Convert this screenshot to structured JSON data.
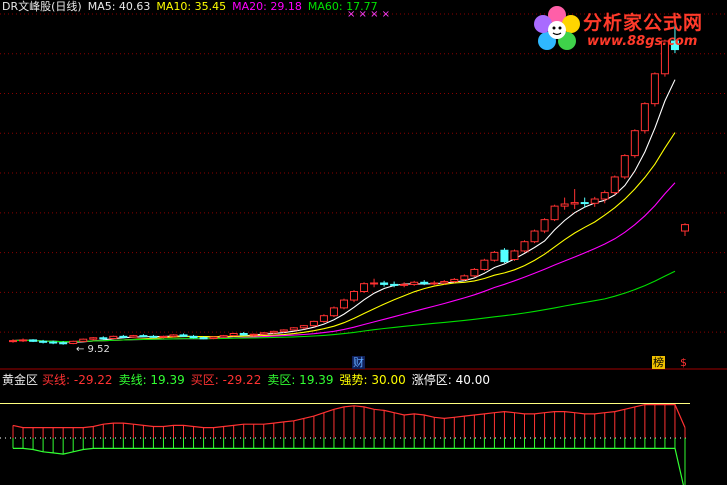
{
  "header": {
    "title": "DR文峰股(日线)",
    "ma5": "MA5: 40.63",
    "ma10": "MA10: 35.45",
    "ma20": "MA20: 29.18",
    "ma60": "MA60: 17.77",
    "x_marks": "× × × ×"
  },
  "lower_header": {
    "name": "黄金区",
    "buy_line": "买线: -29.22",
    "sell_line": "卖线: 19.39",
    "buy_zone": "买区: -29.22",
    "sell_zone": "卖区: 19.39",
    "strong": "强势: 30.00",
    "limit_zone": "涨停区: 40.00"
  },
  "markers": {
    "low_price": "← 9.52",
    "cai": "财",
    "bang": "榜",
    "dollar": "$"
  },
  "logo": {
    "title": "分析家公式网",
    "url": "www.88gs.com"
  },
  "colors": {
    "up": "#ff3232",
    "down": "#54ffff",
    "ma5": "#ffffff",
    "ma10": "#ffff00",
    "ma20": "#ff00ff",
    "ma60": "#00e000",
    "grid": "#8b0000",
    "zone_line": "#ffff80"
  },
  "chart_data": [
    {
      "type": "candlestick",
      "y_range": [
        8.5,
        56
      ],
      "candles": [
        [
          10,
          10.3,
          9.8,
          10.1
        ],
        [
          10.1,
          10.4,
          9.9,
          10.2
        ],
        [
          10.2,
          10.3,
          9.9,
          10.0
        ],
        [
          10,
          10.2,
          9.7,
          9.9
        ],
        [
          9.9,
          10.1,
          9.6,
          9.8
        ],
        [
          9.8,
          10,
          9.52,
          9.7
        ],
        [
          9.7,
          10.1,
          9.6,
          10.0
        ],
        [
          10,
          10.4,
          9.9,
          10.3
        ],
        [
          10.3,
          10.6,
          10.1,
          10.5
        ],
        [
          10.5,
          10.7,
          10.2,
          10.4
        ],
        [
          10.4,
          10.8,
          10.3,
          10.7
        ],
        [
          10.7,
          10.9,
          10.4,
          10.6
        ],
        [
          10.6,
          10.9,
          10.5,
          10.8
        ],
        [
          10.8,
          11,
          10.6,
          10.7
        ],
        [
          10.7,
          10.9,
          10.5,
          10.6
        ],
        [
          10.6,
          10.8,
          10.4,
          10.7
        ],
        [
          10.7,
          11,
          10.5,
          10.9
        ],
        [
          10.9,
          11.1,
          10.6,
          10.7
        ],
        [
          10.7,
          10.9,
          10.4,
          10.5
        ],
        [
          10.5,
          10.7,
          10.3,
          10.4
        ],
        [
          10.4,
          10.7,
          10.3,
          10.6
        ],
        [
          10.6,
          10.9,
          10.5,
          10.8
        ],
        [
          10.8,
          11.2,
          10.7,
          11.1
        ],
        [
          11.1,
          11.3,
          10.8,
          10.9
        ],
        [
          10.9,
          11.1,
          10.7,
          11.0
        ],
        [
          11,
          11.3,
          10.9,
          11.2
        ],
        [
          11.2,
          11.5,
          11,
          11.4
        ],
        [
          11.4,
          11.7,
          11.2,
          11.6
        ],
        [
          11.6,
          12,
          11.5,
          11.9
        ],
        [
          11.9,
          12.3,
          11.7,
          12.2
        ],
        [
          12.2,
          12.9,
          12,
          12.8
        ],
        [
          12.8,
          13.8,
          12.6,
          13.6
        ],
        [
          13.6,
          14.9,
          13.4,
          14.7
        ],
        [
          14.7,
          16,
          14.5,
          15.8
        ],
        [
          15.8,
          17.2,
          15.5,
          17.0
        ],
        [
          17,
          18.3,
          16.8,
          18.1
        ],
        [
          18.1,
          18.8,
          17.6,
          18.2
        ],
        [
          18.2,
          18.5,
          17.7,
          18.0
        ],
        [
          18,
          18.4,
          17.6,
          17.9
        ],
        [
          17.9,
          18.3,
          17.6,
          18.0
        ],
        [
          18,
          18.5,
          17.8,
          18.3
        ],
        [
          18.3,
          18.6,
          17.9,
          18.1
        ],
        [
          18.1,
          18.5,
          17.9,
          18.2
        ],
        [
          18.2,
          18.6,
          18,
          18.4
        ],
        [
          18.4,
          18.9,
          18.2,
          18.7
        ],
        [
          18.7,
          19.4,
          18.5,
          19.2
        ],
        [
          19.2,
          20.3,
          19,
          20.1
        ],
        [
          20.1,
          21.6,
          19.9,
          21.4
        ],
        [
          21.4,
          22.7,
          21.2,
          22.5
        ],
        [
          22.8,
          23.1,
          21.0,
          21.2
        ],
        [
          21.5,
          22.9,
          21.3,
          22.7
        ],
        [
          22.7,
          24.2,
          22.5,
          24.0
        ],
        [
          24,
          25.7,
          23.8,
          25.5
        ],
        [
          25.5,
          27.3,
          25.2,
          27.1
        ],
        [
          27.1,
          29.2,
          26.9,
          29.0
        ],
        [
          29,
          30.2,
          28.5,
          29.3
        ],
        [
          29.3,
          31.4,
          28.6,
          29.5
        ],
        [
          29.5,
          30.2,
          28.8,
          29.4
        ],
        [
          29.4,
          30.3,
          28.9,
          30.0
        ],
        [
          30,
          31.2,
          29.4,
          30.9
        ],
        [
          30.9,
          33.3,
          30.6,
          33.1
        ],
        [
          33.1,
          36.3,
          32.8,
          36.1
        ],
        [
          36.1,
          39.8,
          35.8,
          39.6
        ],
        [
          39.6,
          43.6,
          39.2,
          43.4
        ],
        [
          43.4,
          47.8,
          43,
          47.6
        ],
        [
          47.6,
          52.4,
          47.2,
          52.2
        ],
        [
          52.2,
          55.5,
          50.5,
          51.0
        ],
        [
          25.5,
          26.6,
          24.8,
          26.4
        ]
      ]
    },
    {
      "type": "bar",
      "y_range": [
        -40,
        40
      ],
      "buy_line": -29.22,
      "sell_line": 19.39,
      "strong": 30.0,
      "limit_zone": 40.0,
      "values": [
        2,
        0,
        -1,
        -3,
        -4,
        -5,
        -3,
        -1,
        1,
        3,
        4,
        4,
        3,
        2,
        1,
        1,
        2,
        2,
        1,
        0,
        0,
        1,
        2,
        3,
        3,
        3,
        4,
        5,
        6,
        8,
        10,
        13,
        16,
        18,
        19,
        18,
        16,
        15,
        13,
        11,
        12,
        11,
        9,
        8,
        9,
        10,
        11,
        12,
        13,
        14,
        13,
        12,
        12,
        13,
        14,
        14,
        13,
        12,
        12,
        13,
        14,
        16,
        18,
        20,
        20,
        20,
        20,
        -38
      ]
    }
  ]
}
